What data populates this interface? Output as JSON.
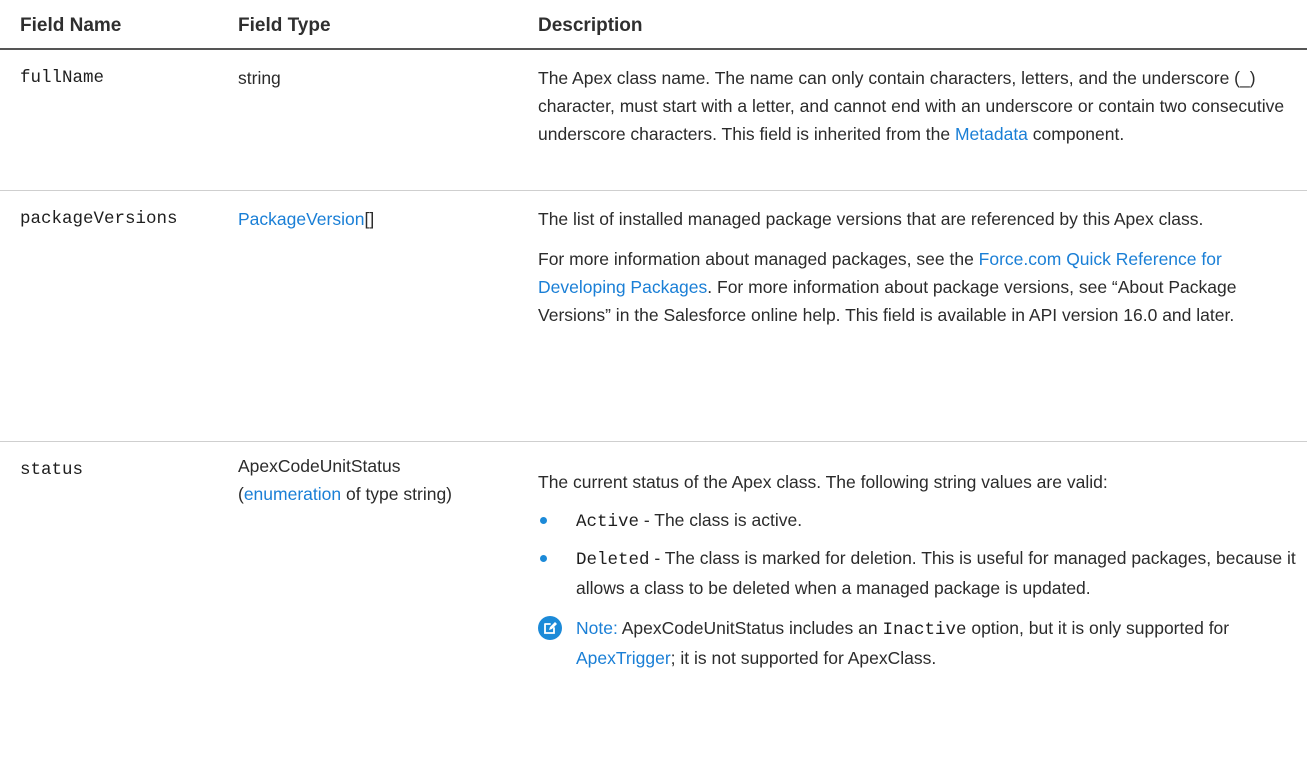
{
  "header": {
    "field_name": "Field Name",
    "field_type": "Field Type",
    "description": "Description"
  },
  "rows": [
    {
      "name": "fullName",
      "type_text": "string",
      "desc": {
        "part1": "The Apex class name. The name can only contain characters, letters, and the underscore (_) character, must start with a letter, and cannot end with an underscore or contain two consecutive underscore characters. This field is inherited from the ",
        "link": "Metadata",
        "part2": " component."
      }
    },
    {
      "name": "packageVersions",
      "type_link": "PackageVersion",
      "type_suffix": "[]",
      "desc": {
        "p1": "The list of installed managed package versions that are referenced by this Apex class.",
        "p2_part1": "For more information about managed packages, see the ",
        "p2_link": "Force.com Quick Reference for Developing Packages",
        "p2_part2": ". For more information about package versions, see “About Package Versions” in the Salesforce online help. This field is available in API version 16.0 and later."
      }
    },
    {
      "name": "status",
      "type_line1": "ApexCodeUnitStatus",
      "type_paren_open": "(",
      "type_link": "enumeration",
      "type_rest": " of type string)",
      "desc": {
        "p1": "The current status of the Apex class. The following string values are valid:",
        "bullets": [
          {
            "code": "Active",
            "text": " - The class is active."
          },
          {
            "code": "Deleted",
            "text": " - The class is marked for deletion. This is useful for managed packages, because it allows a class to be deleted when a managed package is updated."
          }
        ],
        "note_label": "Note:",
        "note_part1": " ApexCodeUnitStatus includes an ",
        "note_code": "Inactive",
        "note_part2": " option, but it is only supported for ",
        "note_link": "ApexTrigger",
        "note_part3": "; it is not supported for ApexClass."
      }
    }
  ],
  "colors": {
    "link": "#1a7fd6",
    "accent": "#1c8ad8",
    "text": "#2b2b2b"
  },
  "icons": {
    "note": "note-edit-icon",
    "bullet": "bullet-dot"
  }
}
